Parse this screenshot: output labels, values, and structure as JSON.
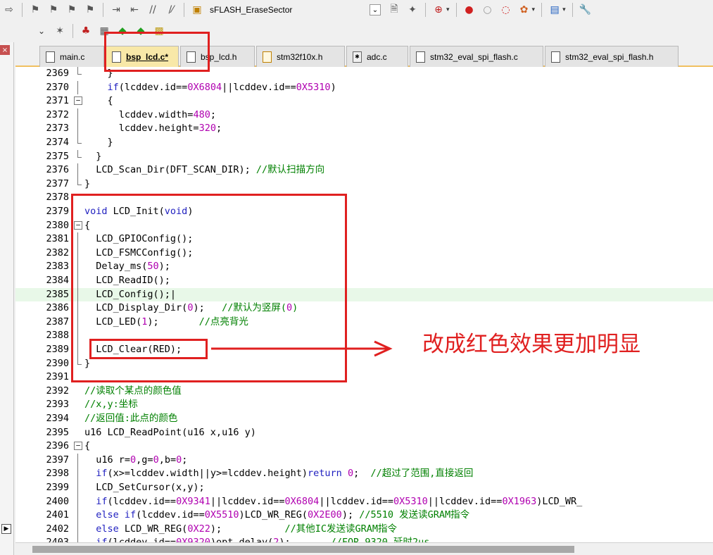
{
  "toolbar": {
    "target_combo": "sFLASH_EraseSector",
    "icons_row1": [
      "back-arrow-icon",
      "bookmark-icon",
      "bookmark-prev-icon",
      "bookmark-next-icon",
      "bookmark-clear-icon",
      "indent-icon",
      "unindent-icon",
      "comment-icon",
      "uncomment-icon",
      "load-icon"
    ],
    "icons_row1b": [
      "find-in-files-icon",
      "search-icon",
      "zoom-icon",
      "debug-breakpoint-icon",
      "breakpoint-disable-icon",
      "breakpoint-kill-icon",
      "config-icon",
      "window-icon",
      "wrench-icon"
    ],
    "icons_row2": [
      "translate-icon",
      "build-icon",
      "rebuild-icon",
      "download-icon",
      "batch-build-icon",
      "stop-build-icon"
    ]
  },
  "tabs": [
    {
      "label": "main.c",
      "type": "c"
    },
    {
      "label": "bsp_lcd.c*",
      "type": "c",
      "active": true
    },
    {
      "label": "bsp_lcd.h",
      "type": "c"
    },
    {
      "label": "stm32f10x.h",
      "type": "h"
    },
    {
      "label": "adc.c",
      "type": "c2"
    },
    {
      "label": "stm32_eval_spi_flash.c",
      "type": "c"
    },
    {
      "label": "stm32_eval_spi_flash.h",
      "type": "c"
    }
  ],
  "code_lines": [
    {
      "n": "2369",
      "fold": "end",
      "html": "    }"
    },
    {
      "n": "2370",
      "fold": "line",
      "html": "    <span class=\"kw\">if</span>(lcddev.id==<span class=\"num\">0X6804</span>||lcddev.id==<span class=\"num\">0X5310</span>)"
    },
    {
      "n": "2371",
      "fold": "box",
      "html": "    {"
    },
    {
      "n": "2372",
      "fold": "line",
      "html": "      lcddev.width=<span class=\"num\">480</span>;"
    },
    {
      "n": "2373",
      "fold": "line",
      "html": "      lcddev.height=<span class=\"num\">320</span>;"
    },
    {
      "n": "2374",
      "fold": "end",
      "html": "    }"
    },
    {
      "n": "2375",
      "fold": "end",
      "html": "  }"
    },
    {
      "n": "2376",
      "fold": "line",
      "html": "  LCD_Scan_Dir(DFT_SCAN_DIR); <span class=\"cm\">//默认扫描方向</span>"
    },
    {
      "n": "2377",
      "fold": "end",
      "html": "}"
    },
    {
      "n": "2378",
      "fold": "",
      "html": ""
    },
    {
      "n": "2379",
      "fold": "",
      "html": "<span class=\"kw\">void</span> LCD_Init(<span class=\"kw\">void</span>)"
    },
    {
      "n": "2380",
      "fold": "box",
      "html": "{"
    },
    {
      "n": "2381",
      "fold": "line",
      "html": "  LCD_GPIOConfig();"
    },
    {
      "n": "2382",
      "fold": "line",
      "html": "  LCD_FSMCConfig();"
    },
    {
      "n": "2383",
      "fold": "line",
      "html": "  Delay_ms(<span class=\"num\">50</span>);"
    },
    {
      "n": "2384",
      "fold": "line",
      "html": "  LCD_ReadID();"
    },
    {
      "n": "2385",
      "fold": "line",
      "hl": true,
      "html": "  LCD_Config();|"
    },
    {
      "n": "2386",
      "fold": "line",
      "html": "  LCD_Display_Dir(<span class=\"num\">0</span>);   <span class=\"cm\">//默认为竖屏(<span class=\"num\">0</span>)</span>"
    },
    {
      "n": "2387",
      "fold": "line",
      "html": "  LCD_LED(<span class=\"num\">1</span>);       <span class=\"cm\">//点亮背光</span>"
    },
    {
      "n": "2388",
      "fold": "line",
      "html": ""
    },
    {
      "n": "2389",
      "fold": "line",
      "html": "  LCD_Clear(RED);"
    },
    {
      "n": "2390",
      "fold": "end",
      "html": "}"
    },
    {
      "n": "2391",
      "fold": "",
      "html": ""
    },
    {
      "n": "2392",
      "fold": "",
      "html": "<span class=\"cm\">//读取个某点的颜色值</span>"
    },
    {
      "n": "2393",
      "fold": "",
      "html": "<span class=\"cm\">//x,y:坐标</span>"
    },
    {
      "n": "2394",
      "fold": "",
      "html": "<span class=\"cm\">//返回值:此点的颜色</span>"
    },
    {
      "n": "2395",
      "fold": "",
      "html": "u16 LCD_ReadPoint(u16 x,u16 y)"
    },
    {
      "n": "2396",
      "fold": "box",
      "html": "{"
    },
    {
      "n": "2397",
      "fold": "line",
      "html": "  u16 r=<span class=\"num\">0</span>,g=<span class=\"num\">0</span>,b=<span class=\"num\">0</span>;"
    },
    {
      "n": "2398",
      "fold": "line",
      "html": "  <span class=\"kw\">if</span>(x>=lcddev.width||y>=lcddev.height)<span class=\"kw\">return</span> <span class=\"num\">0</span>;  <span class=\"cm\">//超过了范围,直接返回</span>"
    },
    {
      "n": "2399",
      "fold": "line",
      "html": "  LCD_SetCursor(x,y);"
    },
    {
      "n": "2400",
      "fold": "line",
      "html": "  <span class=\"kw\">if</span>(lcddev.id==<span class=\"num\">0X9341</span>||lcddev.id==<span class=\"num\">0X6804</span>||lcddev.id==<span class=\"num\">0X5310</span>||lcddev.id==<span class=\"num\">0X1963</span>)LCD_WR_"
    },
    {
      "n": "2401",
      "fold": "line",
      "html": "  <span class=\"kw\">else if</span>(lcddev.id==<span class=\"num\">0X5510</span>)LCD_WR_REG(<span class=\"num\">0X2E00</span>); <span class=\"cm\">//5510 发送读GRAM指令</span>"
    },
    {
      "n": "2402",
      "fold": "line",
      "html": "  <span class=\"kw\">else</span> LCD_WR_REG(<span class=\"num\">0X22</span>);           <span class=\"cm\">//其他IC发送读GRAM指令</span>"
    },
    {
      "n": "2403",
      "fold": "line",
      "html": "  <span class=\"kw\">if</span>(lcddev.id==<span class=\"num\">0X9320</span>)opt_delay(<span class=\"num\">2</span>);       <span class=\"cm\">//FOR 9320,延时2us</span>"
    }
  ],
  "annotation": {
    "text": "改成红色效果更加明显",
    "color": "#e02020"
  }
}
